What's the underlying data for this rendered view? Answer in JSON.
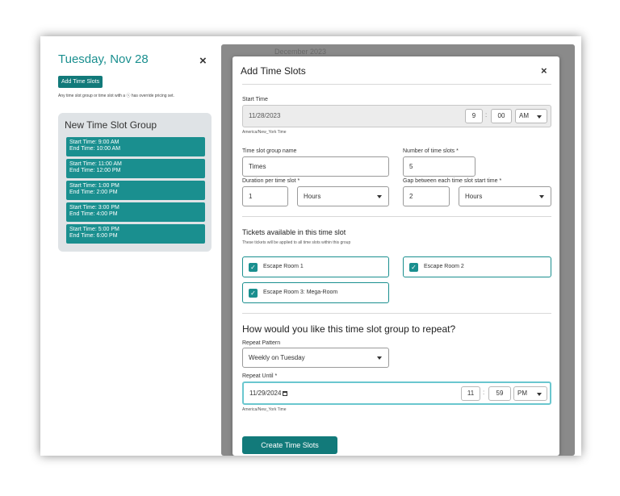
{
  "left_panel": {
    "title": "Tuesday, Nov 28",
    "close_glyph": "×",
    "add_time_slots_label": "Add Time Slots",
    "note": "Any time slot group or time slot with a ⓢ has override pricing set.",
    "group_title": "New Time Slot Group",
    "slots": [
      {
        "start": "Start Time: 9:00 AM",
        "end": "End Time: 10:00 AM"
      },
      {
        "start": "Start Time: 11:00 AM",
        "end": "End Time: 12:00 PM"
      },
      {
        "start": "Start Time: 1:00 PM",
        "end": "End Time: 2:00 PM"
      },
      {
        "start": "Start Time: 3:00 PM",
        "end": "End Time: 4:00 PM"
      },
      {
        "start": "Start Time: 5:00 PM",
        "end": "End Time: 6:00 PM"
      }
    ]
  },
  "background": {
    "calendar_header": "December 2023"
  },
  "modal": {
    "title": "Add Time Slots",
    "close_glyph": "×",
    "start_time": {
      "label": "Start Time",
      "date": "11/28/2023",
      "hour": "9",
      "minute": "00",
      "ampm": "AM",
      "timezone": "America/New_York Time"
    },
    "group_name": {
      "label": "Time slot group name",
      "value": "Times"
    },
    "num_slots": {
      "label": "Number of time slots *",
      "value": "5"
    },
    "duration": {
      "label": "Duration per time slot *",
      "value": "1",
      "unit": "Hours"
    },
    "gap": {
      "label": "Gap between each time slot start time *",
      "value": "2",
      "unit": "Hours"
    },
    "tickets": {
      "heading": "Tickets available in this time slot",
      "subtext": "These tickets will be applied to all time slots within this group",
      "items": [
        {
          "label": "Escape Room 1",
          "checked": true
        },
        {
          "label": "Escape Room 2",
          "checked": true
        },
        {
          "label": "Escape Room 3: Mega-Room",
          "checked": true
        }
      ]
    },
    "repeat": {
      "heading": "How would you like this time slot group to repeat?",
      "pattern_label": "Repeat Pattern",
      "pattern_value": "Weekly on Tuesday",
      "until_label": "Repeat Until *",
      "until_date": "11/29/2024",
      "until_hour": "11",
      "until_minute": "59",
      "until_ampm": "PM",
      "timezone": "America/New_York Time"
    },
    "create_label": "Create Time Slots"
  },
  "colors": {
    "accent": "#1a8f8f",
    "button": "#127a7a",
    "focus_border": "#6ac7cf"
  }
}
